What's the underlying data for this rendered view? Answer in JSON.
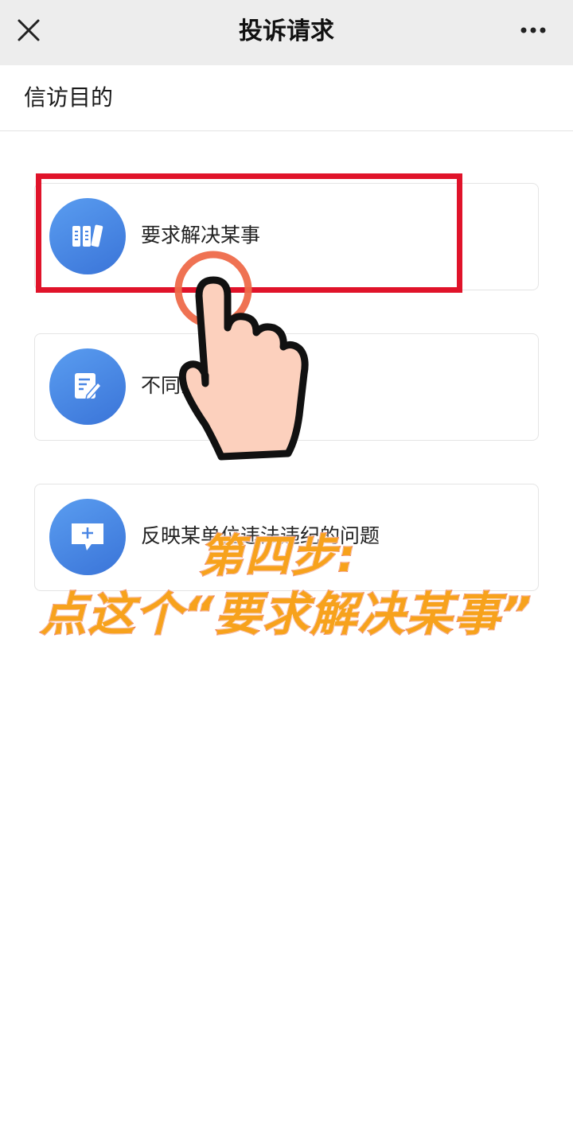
{
  "navbar": {
    "title": "投诉请求",
    "close_icon": "close-icon",
    "more_icon": "more-dots-icon"
  },
  "section": {
    "title": "信访目的"
  },
  "options": [
    {
      "label": "要求解决某事",
      "icon": "bookshelf-icon"
    },
    {
      "label": "不同意",
      "icon": "edit-document-icon"
    },
    {
      "label": "反映某单位违法违纪的问题",
      "icon": "add-comment-icon"
    }
  ],
  "overlay": {
    "step_text": "第四步:",
    "instruction_text": "点这个“要求解决某事”",
    "highlight_color": "#e0132a",
    "caption_color": "#f7a21c"
  },
  "colors": {
    "accent": "#3a74d8",
    "navbar_bg": "#ededed"
  }
}
